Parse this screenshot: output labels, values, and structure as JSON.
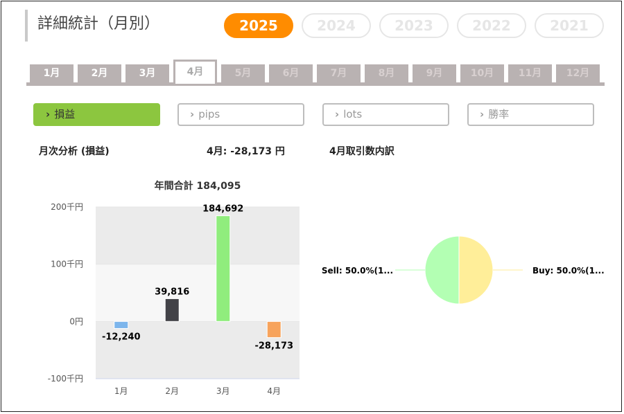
{
  "title": "詳細統計（月別）",
  "years": [
    {
      "label": "2025",
      "active": true
    },
    {
      "label": "2024",
      "active": false
    },
    {
      "label": "2023",
      "active": false
    },
    {
      "label": "2022",
      "active": false
    },
    {
      "label": "2021",
      "active": false
    }
  ],
  "months": [
    "1月",
    "2月",
    "3月",
    "4月",
    "5月",
    "6月",
    "7月",
    "8月",
    "9月",
    "10月",
    "11月",
    "12月"
  ],
  "active_month_index": 3,
  "filters": [
    {
      "label": "損益",
      "active": true
    },
    {
      "label": "pips",
      "active": false
    },
    {
      "label": "lots",
      "active": false
    },
    {
      "label": "勝率",
      "active": false
    }
  ],
  "filter_chevron": "›",
  "analysis": {
    "section_title": "月次分析 (損益)",
    "month_summary": "4月:  -28,173 円",
    "breakdown_title": "4月取引数内訳"
  },
  "colors": {
    "accent": "#ff8c00",
    "filter_active": "#8cc63f",
    "tab": "#b9b2b2"
  },
  "chart_data": [
    {
      "type": "bar",
      "title": "年間合計 184,095",
      "categories": [
        "1月",
        "2月",
        "3月",
        "4月"
      ],
      "values": [
        -12240,
        39816,
        184692,
        -28173
      ],
      "value_labels": [
        "-12,240",
        "39,816",
        "184,692",
        "-28,173"
      ],
      "colors": [
        "#7cb5ec",
        "#434348",
        "#90ed7d",
        "#f7a35c"
      ],
      "y_ticks": [
        {
          "value": 200000,
          "label": "200千円"
        },
        {
          "value": 100000,
          "label": "100千円"
        },
        {
          "value": 0,
          "label": "0円"
        },
        {
          "value": -100000,
          "label": "-100千円"
        }
      ],
      "ylim": [
        -100000,
        200000
      ],
      "grid": true
    },
    {
      "type": "pie",
      "labels": [
        "Sell: 50.0%(1...",
        "Buy: 50.0%(1..."
      ],
      "values": [
        50.0,
        50.0
      ],
      "colors": [
        "#b3ffb3",
        "#ffee99"
      ]
    }
  ]
}
